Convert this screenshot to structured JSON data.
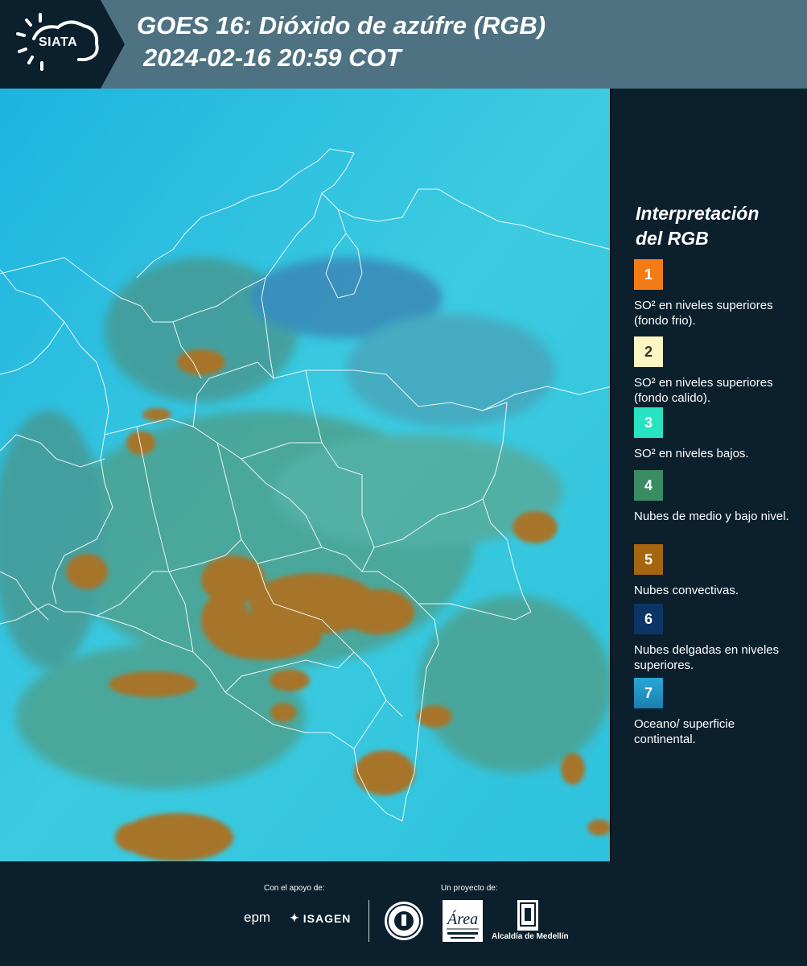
{
  "header": {
    "logo_text": "SIATA",
    "title_line1": "GOES 16: Dióxido de azúfre (RGB)",
    "title_line2": "2024-02-16 20:59 COT"
  },
  "legend": {
    "title_line1": "Interpretación",
    "title_line2": "del RGB",
    "items": [
      {
        "number": "1",
        "color": "#f47c16",
        "description": "SO² en niveles superiores (fondo frio)."
      },
      {
        "number": "2",
        "color": "#fdf6c3",
        "description": "SO² en niveles superiores (fondo calido)."
      },
      {
        "number": "3",
        "color": "#27e3c2",
        "description": "SO² en niveles bajos."
      },
      {
        "number": "4",
        "color": "#3a8c63",
        "description": "Nubes de medio y bajo nivel."
      },
      {
        "number": "5",
        "color": "#a5660f",
        "description": "Nubes convectivas."
      },
      {
        "number": "6",
        "color": "#0c3566",
        "description": "Nubes delgadas en niveles superiores."
      },
      {
        "number": "7",
        "color": "#1f8fc2",
        "description": "Oceano/ superficie continental."
      }
    ]
  },
  "footer": {
    "support_label": "Con el apoyo de:",
    "project_label": "Un proyecto de:",
    "sponsor1": "epm",
    "sponsor2": "ISAGEN",
    "partner1": "Área Metropolitana Valle de Aburrá",
    "partner2": "Alcaldía de Medellín"
  }
}
